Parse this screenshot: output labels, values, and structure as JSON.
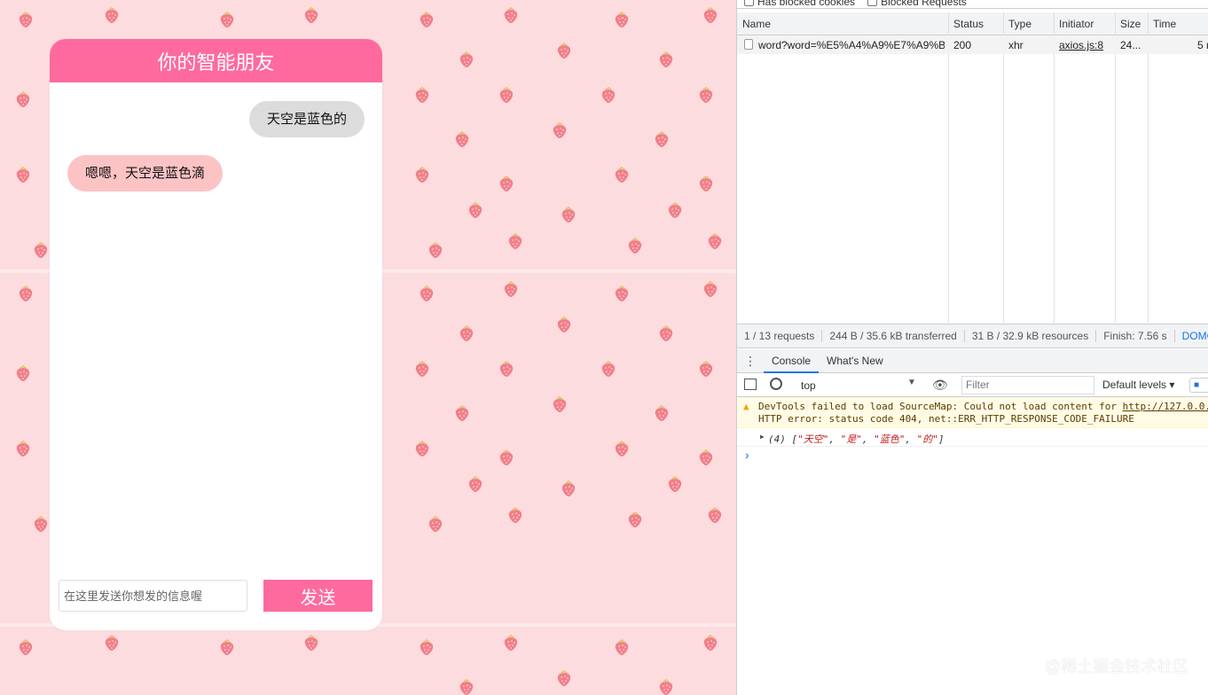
{
  "chat": {
    "title": "你的智能朋友",
    "messages": [
      {
        "role": "user",
        "text": "天空是蓝色的"
      },
      {
        "role": "bot",
        "text": "嗯嗯，天空是蓝色滴"
      }
    ],
    "input_placeholder": "在这里发送你想发的信息喔",
    "send_label": "发送"
  },
  "devtools": {
    "filter_options": [
      "Has blocked cookies",
      "Blocked Requests"
    ],
    "network_columns": [
      "Name",
      "Status",
      "Type",
      "Initiator",
      "Size",
      "Time"
    ],
    "requests": [
      {
        "name": "word?word=%E5%A4%A9%E7%A9%BA...",
        "status": "200",
        "type": "xhr",
        "initiator": "axios.js:8",
        "size": "24...",
        "time": "5 m"
      }
    ],
    "summary": [
      "1 / 13 requests",
      "244 B / 35.6 kB transferred",
      "31 B / 32.9 kB resources",
      "Finish: 7.56 s",
      "DOMC"
    ],
    "drawer_tabs": [
      "Console",
      "What's New"
    ],
    "context": "top",
    "filter_placeholder": "Filter",
    "levels": "Default levels ▾",
    "warning_line1": "DevTools failed to load SourceMap: Could not load content for ",
    "warning_link": "http://127.0.0.",
    "warning_line2": "HTTP error: status code 404, net::ERR_HTTP_RESPONSE_CODE_FAILURE",
    "log": {
      "prefix": "(4) [",
      "items": [
        "\"天空\"",
        "\"是\"",
        "\"蓝色\"",
        "\"的\""
      ],
      "suffix": "]"
    }
  },
  "watermark": "@稀土掘金技术社区",
  "colors": {
    "accent": "#fe6a9e",
    "page_bg": "#fcdcde",
    "user_bubble": "#dcdcdc",
    "bot_bubble": "#fcc3c5"
  }
}
